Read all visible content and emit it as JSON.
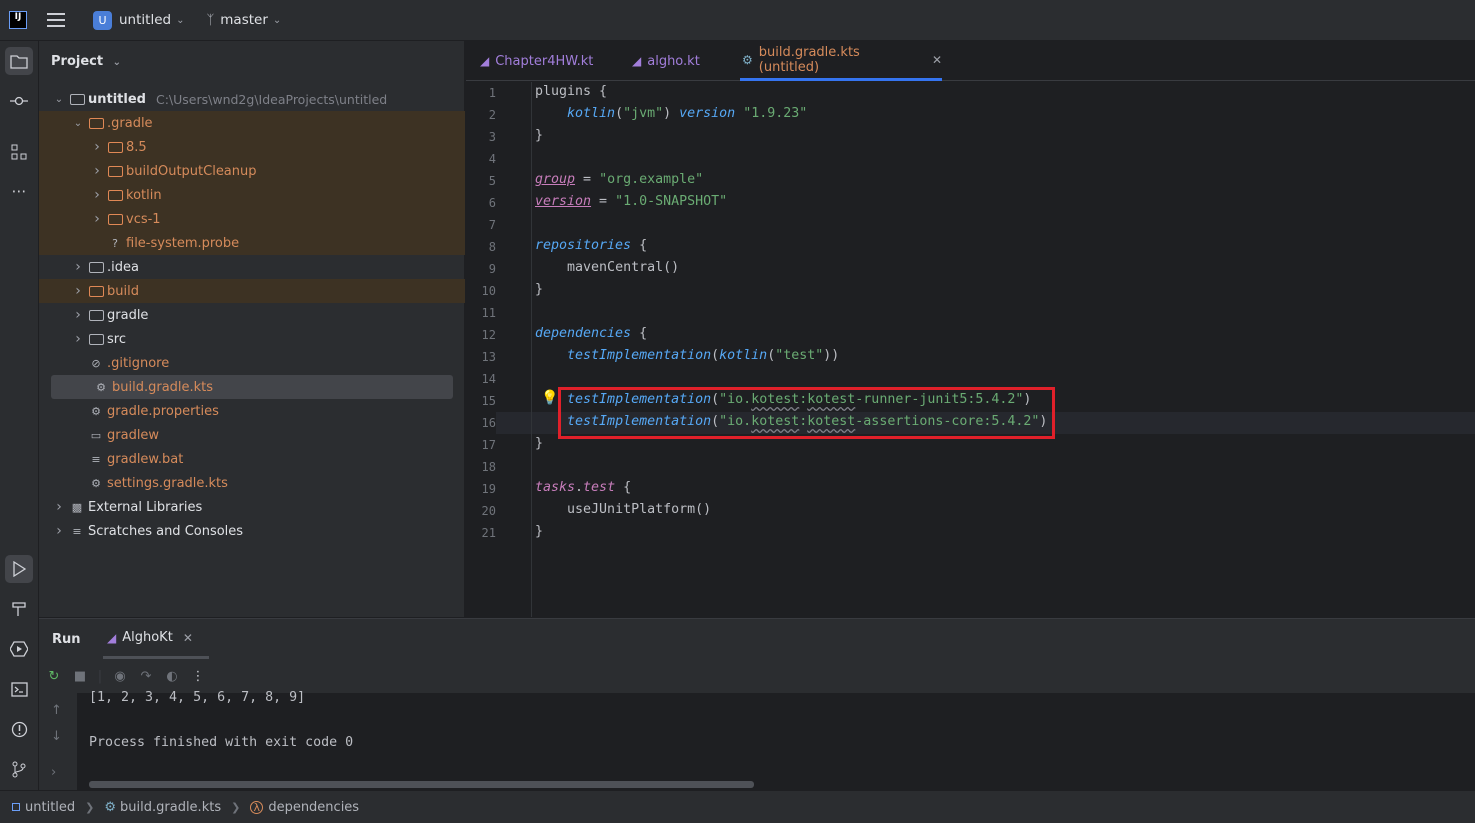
{
  "titlebar": {
    "logo": "IJ",
    "project_badge": "U",
    "project_name": "untitled",
    "branch_name": "master"
  },
  "project_panel": {
    "title": "Project",
    "tree": [
      {
        "label": "untitled",
        "path": "C:\\Users\\wnd2g\\IdeaProjects\\untitled",
        "depth": 0,
        "expanded": true,
        "icon": "module-folder-icon"
      },
      {
        "label": ".gradle",
        "depth": 1,
        "expanded": true,
        "icon": "folder-icon",
        "excluded": true
      },
      {
        "label": "8.5",
        "depth": 2,
        "expanded": false,
        "icon": "folder-icon",
        "excluded": true
      },
      {
        "label": "buildOutputCleanup",
        "depth": 2,
        "expanded": false,
        "icon": "folder-icon",
        "excluded": true
      },
      {
        "label": "kotlin",
        "depth": 2,
        "expanded": false,
        "icon": "folder-icon",
        "excluded": true
      },
      {
        "label": "vcs-1",
        "depth": 2,
        "expanded": false,
        "icon": "folder-icon",
        "excluded": true
      },
      {
        "label": "file-system.probe",
        "depth": 2,
        "icon": "unknown-file-icon",
        "excluded": true,
        "leaf": true
      },
      {
        "label": ".idea",
        "depth": 1,
        "expanded": false,
        "icon": "folder-icon"
      },
      {
        "label": "build",
        "depth": 1,
        "expanded": false,
        "icon": "folder-icon",
        "excluded": true
      },
      {
        "label": "gradle",
        "depth": 1,
        "expanded": false,
        "icon": "folder-icon"
      },
      {
        "label": "src",
        "depth": 1,
        "expanded": false,
        "icon": "folder-icon"
      },
      {
        "label": ".gitignore",
        "depth": 1,
        "icon": "ignore-file-icon",
        "leaf": true,
        "orange": true
      },
      {
        "label": "build.gradle.kts",
        "depth": 1,
        "icon": "gradle-icon",
        "leaf": true,
        "orange": true,
        "selected": true
      },
      {
        "label": "gradle.properties",
        "depth": 1,
        "icon": "settings-file-icon",
        "leaf": true,
        "orange": true
      },
      {
        "label": "gradlew",
        "depth": 1,
        "icon": "terminal-file-icon",
        "leaf": true,
        "orange": true
      },
      {
        "label": "gradlew.bat",
        "depth": 1,
        "icon": "text-file-icon",
        "leaf": true,
        "orange": true
      },
      {
        "label": "settings.gradle.kts",
        "depth": 1,
        "icon": "gradle-icon",
        "leaf": true,
        "orange": true
      },
      {
        "label": "External Libraries",
        "depth": 0,
        "expanded": false,
        "icon": "library-icon"
      },
      {
        "label": "Scratches and Consoles",
        "depth": 0,
        "expanded": false,
        "icon": "scratches-icon"
      }
    ]
  },
  "editor": {
    "tabs": [
      {
        "label": "Chapter4HW.kt",
        "icon": "kotlin-file-icon"
      },
      {
        "label": "algho.kt",
        "icon": "kotlin-file-icon"
      },
      {
        "label": "build.gradle.kts (untitled)",
        "icon": "gradle-icon",
        "active": true
      }
    ],
    "line_numbers": [
      "1",
      "2",
      "3",
      "4",
      "5",
      "6",
      "7",
      "8",
      "9",
      "10",
      "11",
      "12",
      "13",
      "14",
      "15",
      "16",
      "17",
      "18",
      "19",
      "20",
      "21"
    ],
    "code": {
      "l1": "plugins {",
      "l2_fn": "kotlin",
      "l2_arg": "\"jvm\"",
      "l2_kw": "version",
      "l2_val": "\"1.9.23\"",
      "l3": "}",
      "l5_kw": "group",
      "l5_eq": " = ",
      "l5_val": "\"org.example\"",
      "l6_kw": "version",
      "l6_eq": " = ",
      "l6_val": "\"1.0-SNAPSHOT\"",
      "l8_kw": "repositories",
      "l8_rest": " {",
      "l9": "mavenCentral()",
      "l10": "}",
      "l12_kw": "dependencies",
      "l12_rest": " {",
      "l13_fn": "testImplementation",
      "l13_inner": "kotlin",
      "l13_arg": "\"test\"",
      "l15_fn": "testImplementation",
      "l15_a": "\"io.",
      "l15_b": "kotest",
      "l15_c": ":",
      "l15_d": "kotest",
      "l15_e": "-runner-junit5:5.4.2\"",
      "l16_fn": "testImplementation",
      "l16_a": "\"io.",
      "l16_b": "kotest",
      "l16_c": ":",
      "l16_d": "kotest",
      "l16_e": "-assertions-core:5.4.2\"",
      "l17": "}",
      "l19_a": "tasks",
      "l19_b": "test",
      "l19_rest": " {",
      "l20": "useJUnitPlatform()",
      "l21": "}"
    }
  },
  "run_panel": {
    "title": "Run",
    "tab_label": "AlghoKt",
    "output_line1": "[1, 2, 3, 4, 5, 6, 7, 8, 9]",
    "output_line2": "Process finished with exit code 0"
  },
  "statusbar": {
    "project": "untitled",
    "file": "build.gradle.kts",
    "scope": "dependencies"
  }
}
